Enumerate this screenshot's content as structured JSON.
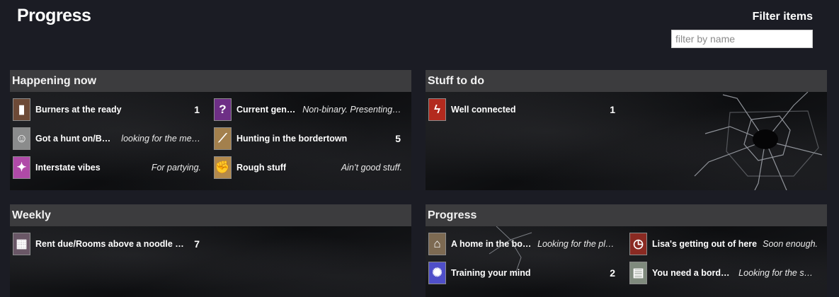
{
  "page": {
    "title": "Progress"
  },
  "filter": {
    "label": "Filter items",
    "placeholder": "filter by name",
    "value": ""
  },
  "panels": [
    {
      "title": "Happening now",
      "items": [
        {
          "name": "Burners at the ready",
          "count": "1",
          "desc": "",
          "icon": "phone-icon",
          "icon_glyph": "▮",
          "icon_color": "#6d4a36"
        },
        {
          "name": "Current gender",
          "count": "",
          "desc": "Non-binary. Presenting s…",
          "icon": "question-icon",
          "icon_glyph": "?",
          "icon_color": "#6e2f86"
        },
        {
          "name": "Got a hunt on/Bor…",
          "count": "",
          "desc": "looking for the mec…",
          "icon": "portrait-icon",
          "icon_glyph": "☺",
          "icon_color": "#8b8c8c"
        },
        {
          "name": "Hunting in the bordertown",
          "count": "5",
          "desc": "",
          "icon": "knife-icon",
          "icon_glyph": "⟋",
          "icon_color": "#a3804d"
        },
        {
          "name": "Interstate vibes",
          "count": "",
          "desc": "For partying.",
          "icon": "party-icon",
          "icon_glyph": "✦",
          "icon_color": "#b04aa8"
        },
        {
          "name": "Rough stuff",
          "count": "",
          "desc": "Ain’t good stuff.",
          "icon": "hand-icon",
          "icon_glyph": "✊",
          "icon_color": "#b2894c"
        }
      ]
    },
    {
      "title": "Stuff to do",
      "items": [
        {
          "name": "Well connected",
          "count": "1",
          "desc": "",
          "icon": "lightning-icon",
          "icon_glyph": "ϟ",
          "icon_color": "#b32a1e"
        }
      ]
    },
    {
      "title": "Weekly",
      "items": [
        {
          "name": "Rent due/Rooms above a noodle bar",
          "count": "7",
          "desc": "",
          "icon": "building-icon",
          "icon_glyph": "▦",
          "icon_color": "#6a5766"
        }
      ]
    },
    {
      "title": "Progress",
      "items": [
        {
          "name": "A home in the bor…",
          "count": "",
          "desc": "Looking for the place",
          "icon": "house-icon",
          "icon_glyph": "⌂",
          "icon_color": "#7d6a52"
        },
        {
          "name": "Lisa's getting out of here",
          "count": "",
          "desc": "Soon enough.",
          "icon": "clock-icon",
          "icon_glyph": "◷",
          "icon_color": "#8a2a22"
        },
        {
          "name": "Training your mind",
          "count": "2",
          "desc": "",
          "icon": "brain-icon",
          "icon_glyph": "✺",
          "icon_color": "#4f4fc9"
        },
        {
          "name": "You need a border…",
          "count": "",
          "desc": "Looking for the sou…",
          "icon": "id-card-icon",
          "icon_glyph": "▤",
          "icon_color": "#7f8a7d"
        }
      ]
    }
  ]
}
